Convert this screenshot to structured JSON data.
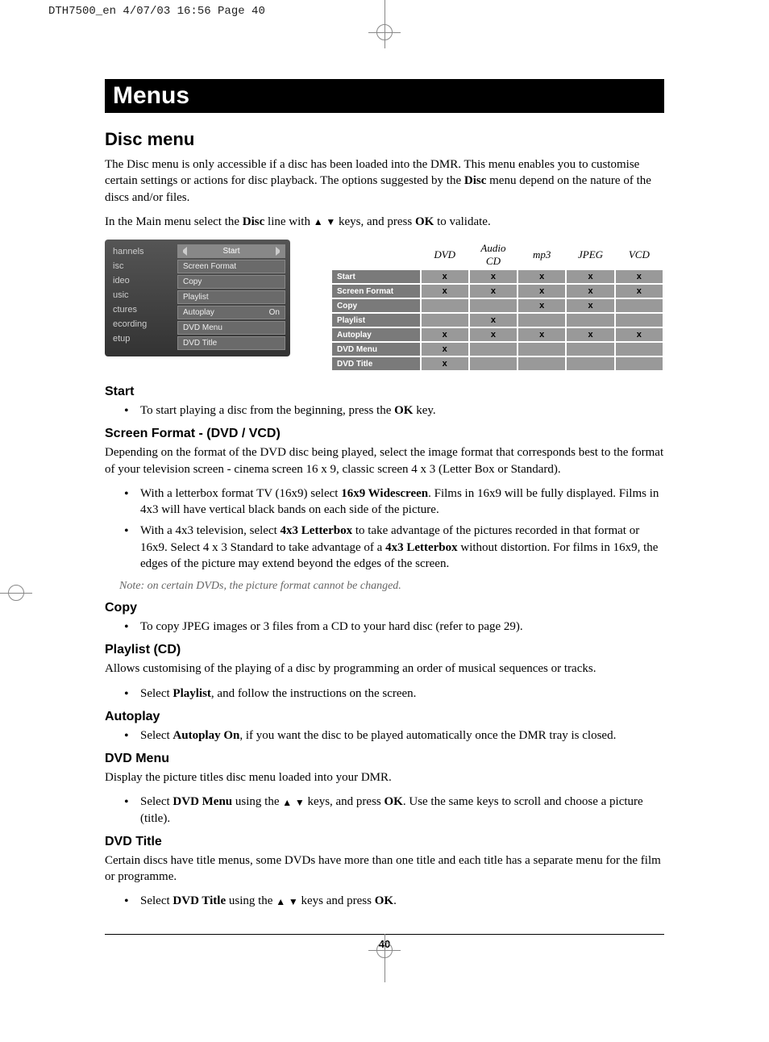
{
  "pageHeader": "DTH7500_en  4/07/03  16:56  Page 40",
  "titleBar": "Menus",
  "sectionHeading": "Disc menu",
  "intro1a": "The Disc menu is only accessible if a disc has been loaded into the DMR. This menu enables you to customise certain settings or actions for disc playback. The options suggested by the ",
  "intro1b": "Disc",
  "intro1c": " menu depend on the nature of the discs and/or files.",
  "intro2a": "In the Main menu select the ",
  "intro2b": "Disc",
  "intro2c": " line with ",
  "intro2d": " keys, and press ",
  "intro2e": "OK",
  "intro2f": " to validate.",
  "leftMenu": [
    "hannels",
    "isc",
    "ideo",
    "usic",
    "ctures",
    "ecording",
    "etup"
  ],
  "rightMenu": [
    {
      "label": "Start",
      "val": "",
      "selected": true,
      "arrows": true
    },
    {
      "label": "Screen Format",
      "val": ""
    },
    {
      "label": "Copy",
      "val": ""
    },
    {
      "label": "Playlist",
      "val": ""
    },
    {
      "label": "Autoplay",
      "val": "On"
    },
    {
      "label": "DVD Menu",
      "val": ""
    },
    {
      "label": "DVD Title",
      "val": ""
    }
  ],
  "tableCols": [
    "DVD",
    "Audio CD",
    "mp3",
    "JPEG",
    "VCD"
  ],
  "tableRows": [
    {
      "h": "Start",
      "c": [
        "x",
        "x",
        "x",
        "x",
        "x"
      ]
    },
    {
      "h": "Screen Format",
      "c": [
        "x",
        "x",
        "x",
        "x",
        "x"
      ]
    },
    {
      "h": "Copy",
      "c": [
        "",
        "",
        "x",
        "x",
        ""
      ]
    },
    {
      "h": "Playlist",
      "c": [
        "",
        "x",
        "",
        "",
        ""
      ]
    },
    {
      "h": "Autoplay",
      "c": [
        "x",
        "x",
        "x",
        "x",
        "x"
      ]
    },
    {
      "h": "DVD Menu",
      "c": [
        "x",
        "",
        "",
        "",
        ""
      ]
    },
    {
      "h": "DVD Title",
      "c": [
        "x",
        "",
        "",
        "",
        ""
      ]
    }
  ],
  "sec_start_h": "Start",
  "sec_start_b1a": "To start playing a disc from the beginning, press the ",
  "sec_start_b1b": "OK",
  "sec_start_b1c": " key.",
  "sec_sf_h": "Screen Format - (DVD / VCD)",
  "sec_sf_p": "Depending on the format of the DVD disc being played, select the image format that corresponds best to the format of your television screen - cinema screen 16 x 9, classic screen 4 x 3 (Letter Box or Standard).",
  "sec_sf_b1a": "With a letterbox format TV (16x9) select ",
  "sec_sf_b1b": "16x9 Widescreen",
  "sec_sf_b1c": ". Films in 16x9 will be fully displayed. Films in 4x3 will have vertical black bands on each side of the picture.",
  "sec_sf_b2a": "With a 4x3 television, select ",
  "sec_sf_b2b": "4x3 Letterbox",
  "sec_sf_b2c": " to take advantage of the pictures recorded in that format or 16x9. Select 4 x 3 Standard to take advantage of a ",
  "sec_sf_b2d": "4x3 Letterbox",
  "sec_sf_b2e": " without distortion. For films in 16x9, the edges of the picture may extend beyond the edges of the screen.",
  "sec_sf_note": "Note: on certain DVDs, the picture format cannot be changed.",
  "sec_copy_h": "Copy",
  "sec_copy_b1": "To copy JPEG images or 3 files from a CD to your hard disc (refer to page 29).",
  "sec_pl_h": "Playlist (CD)",
  "sec_pl_p": "Allows customising of the playing of a disc by programming an order of musical sequences or tracks.",
  "sec_pl_b1a": "Select ",
  "sec_pl_b1b": "Playlist",
  "sec_pl_b1c": ", and follow the instructions on the screen.",
  "sec_ap_h": "Autoplay",
  "sec_ap_b1a": "Select ",
  "sec_ap_b1b": "Autoplay On",
  "sec_ap_b1c": ", if you want the disc to be played automatically once the DMR tray is closed.",
  "sec_dm_h": "DVD Menu",
  "sec_dm_p": "Display the picture titles disc menu loaded into your DMR.",
  "sec_dm_b1a": "Select ",
  "sec_dm_b1b": "DVD Menu",
  "sec_dm_b1c": " using the ",
  "sec_dm_b1d": " keys, and press ",
  "sec_dm_b1e": "OK",
  "sec_dm_b1f": ". Use the same keys to scroll and choose a picture (title).",
  "sec_dt_h": "DVD Title",
  "sec_dt_p": "Certain discs have title menus, some DVDs have more than one title and each title has a separate menu for the film or programme.",
  "sec_dt_b1a": "Select ",
  "sec_dt_b1b": "DVD Title",
  "sec_dt_b1c": " using the ",
  "sec_dt_b1d": " keys and press ",
  "sec_dt_b1e": "OK",
  "sec_dt_b1f": ".",
  "pageNumber": "40"
}
